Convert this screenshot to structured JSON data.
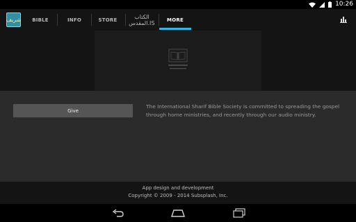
{
  "status_bar": {
    "time": "10:26"
  },
  "app": {
    "logo_text": "شريف"
  },
  "tabs": [
    {
      "label": "BIBLE",
      "active": false
    },
    {
      "label": "INFO",
      "active": false
    },
    {
      "label": "STORE",
      "active": false
    },
    {
      "label_line1": "الكتاب",
      "label_line2": "المقدس.IS",
      "active": false
    },
    {
      "label": "MORE",
      "active": true
    }
  ],
  "actions": {
    "stats_icon": "bar-chart-icon"
  },
  "main": {
    "give_label": "Give",
    "mission_text": "The International Sharif Bible Society is committed to spreading the gospel through home ministries, and recently through our audio ministry."
  },
  "footer": {
    "line1": "App design and development",
    "line2": "Copyright © 2009 - 2014 Subsplash, Inc."
  },
  "nav": {
    "back_icon": "back-icon",
    "home_icon": "home-icon",
    "recents_icon": "recents-icon"
  },
  "colors": {
    "accent": "#33b5e5",
    "background": "#2b2b2b",
    "bar": "#141414"
  }
}
